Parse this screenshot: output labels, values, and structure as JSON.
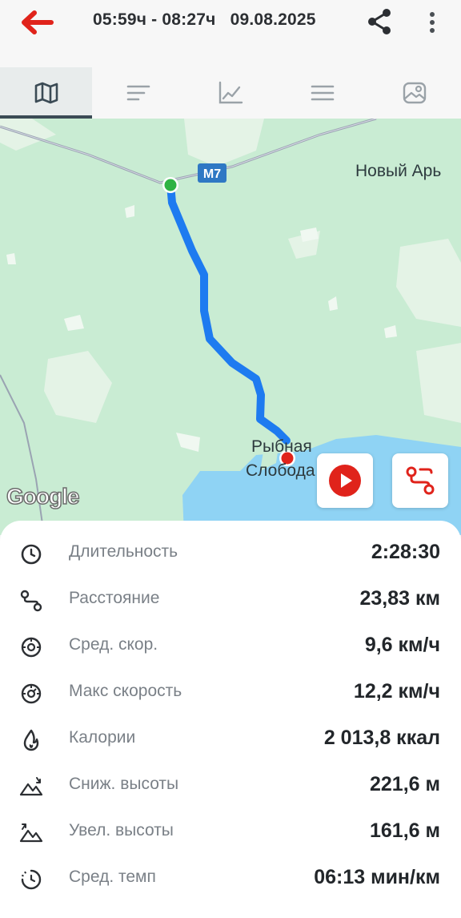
{
  "header": {
    "title": "05:59ч - 08:27ч   09.08.2025"
  },
  "tabs": [
    {
      "name": "map",
      "icon": "map-icon",
      "active": true
    },
    {
      "name": "splits",
      "icon": "bars-icon",
      "active": false
    },
    {
      "name": "chart",
      "icon": "chart-icon",
      "active": false
    },
    {
      "name": "details",
      "icon": "menu-lines-icon",
      "active": false
    },
    {
      "name": "photo",
      "icon": "image-icon",
      "active": false
    }
  ],
  "map": {
    "road_badge": "M7",
    "town_top": "Новый Арь",
    "town_bottom_line1": "Рыбная",
    "town_bottom_line2": "Слобода",
    "google_logo": "Google",
    "route_color": "#1e7bf0",
    "start_color": "#2fb344",
    "end_color": "#e0231b"
  },
  "stats": [
    {
      "label": "Длительность",
      "value": "2:28:30",
      "icon": "clock-icon"
    },
    {
      "label": "Расстояние",
      "value": "23,83 км",
      "icon": "route-icon"
    },
    {
      "label": "Сред. скор.",
      "value": "9,6 км/ч",
      "icon": "speedometer-icon"
    },
    {
      "label": "Макс скорость",
      "value": "12,2 км/ч",
      "icon": "speedometer-max-icon"
    },
    {
      "label": "Калории",
      "value": "2 013,8 ккал",
      "icon": "flame-icon"
    },
    {
      "label": "Сниж. высоты",
      "value": "221,6 м",
      "icon": "descent-icon"
    },
    {
      "label": "Увел. высоты",
      "value": "161,6 м",
      "icon": "ascent-icon"
    },
    {
      "label": "Сред. темп",
      "value": "06:13 мин/км",
      "icon": "pace-icon"
    }
  ],
  "colors": {
    "back_arrow": "#e0231b",
    "accent": "#3b4b55",
    "water": "#8fd3f4",
    "forest": "#c9ecd3"
  }
}
